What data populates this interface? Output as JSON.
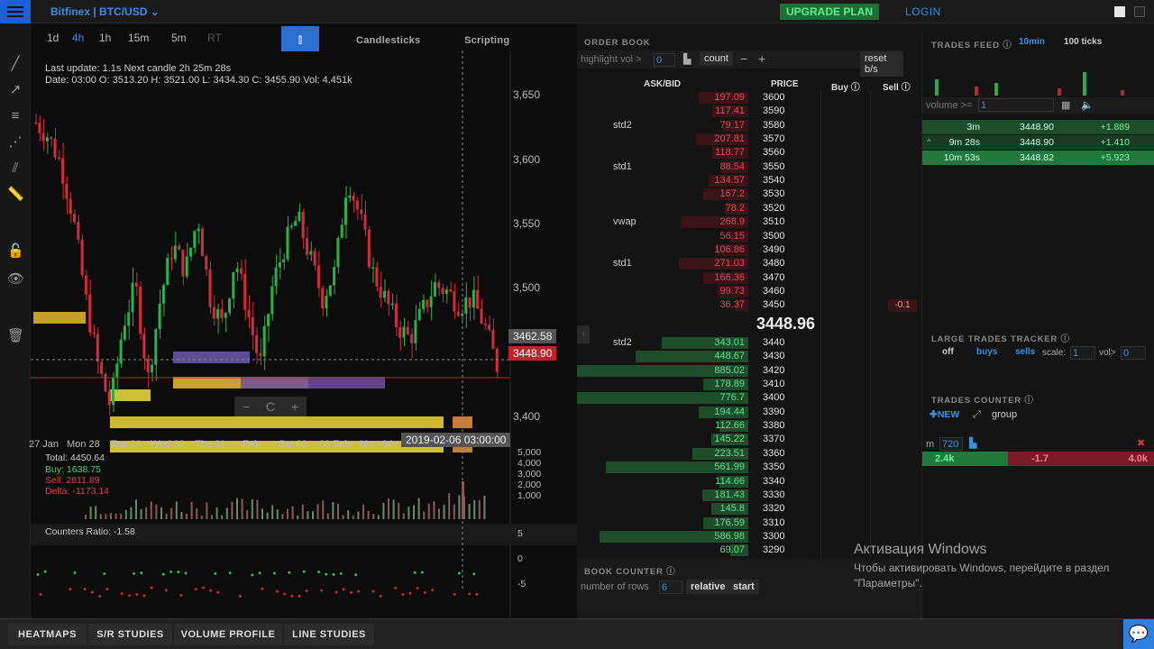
{
  "header": {
    "pair": "Bitfinex | BTC/USD",
    "upgrade": "UPGRADE PLAN",
    "login": "LOGIN"
  },
  "timeframes": [
    "1d",
    "4h",
    "1h",
    "15m",
    "5m",
    "RT"
  ],
  "tabs": {
    "candles": "Candlesticks",
    "scripting": "Scripting"
  },
  "chart": {
    "info1": "Last update: 1.1s   Next candle 2h 25m 28s",
    "info2": "Date: 03:00 O: 3513.20 H: 3521.00 L: 3434.30 C: 3455.90 Vol: 4.451k",
    "price_ticks": [
      "3,650",
      "3,600",
      "3,550",
      "3,500",
      "3,400"
    ],
    "dates": [
      "27 Jan",
      "Mon 28",
      "Tue 29",
      "Wed 30",
      "Thu 31",
      "Feb",
      "Sat 02",
      "03 Feb",
      "Mon 04"
    ],
    "crosshair_price": "3462.58",
    "last_price": "3448.90",
    "crosshair_date": "2019-02-06 03:00:00",
    "vol_ticks": [
      "5,000",
      "4,000",
      "3,000",
      "2,000",
      "1,000"
    ],
    "total": "Total: 4450.64",
    "buy": "Buy: 1638.75",
    "sell": "Sell: 2811.89",
    "delta": "Delta: -1173.14",
    "counters_ratio": "Counters Ratio: -1.58",
    "ratio_ticks": [
      "5",
      "0",
      "-5"
    ],
    "zoom_minus": "−",
    "zoom_reset": "C",
    "zoom_plus": "+"
  },
  "chart_data": {
    "type": "candlestick",
    "ylim": [
      3390,
      3670
    ],
    "title": ""
  },
  "orderbook": {
    "title": "ORDER BOOK",
    "highlight_label": "highlight vol >",
    "highlight_value": "0",
    "count": "count",
    "reset": "reset b/s",
    "col_askbid": "ASK/BID",
    "col_price": "PRICE",
    "col_buy": "Buy",
    "col_sell": "Sell",
    "asks": [
      {
        "v": "197.09",
        "p": "3600",
        "w": 55
      },
      {
        "v": "117.41",
        "p": "3590",
        "w": 40
      },
      {
        "v": "79.17",
        "p": "3580",
        "w": 28,
        "l": "std2"
      },
      {
        "v": "207.81",
        "p": "3570",
        "w": 58
      },
      {
        "v": "118.77",
        "p": "3560",
        "w": 40
      },
      {
        "v": "88.54",
        "p": "3550",
        "w": 30,
        "l": "std1"
      },
      {
        "v": "134.57",
        "p": "3540",
        "w": 44
      },
      {
        "v": "167.2",
        "p": "3530",
        "w": 50
      },
      {
        "v": "78.2",
        "p": "3520",
        "w": 26
      },
      {
        "v": "268.9",
        "p": "3510",
        "w": 75,
        "l": "vwap"
      },
      {
        "v": "56.15",
        "p": "3500",
        "w": 20
      },
      {
        "v": "106.86",
        "p": "3490",
        "w": 36
      },
      {
        "v": "271.03",
        "p": "3480",
        "w": 77,
        "l": "std1"
      },
      {
        "v": "166.36",
        "p": "3470",
        "w": 50
      },
      {
        "v": "99.73",
        "p": "3460",
        "w": 34
      },
      {
        "v": "36.37",
        "p": "3450",
        "w": 14
      }
    ],
    "mid": "3448.96",
    "sell_val": "-0.1",
    "bids": [
      {
        "v": "343.01",
        "p": "3440",
        "w": 96,
        "l": "std2"
      },
      {
        "v": "448.67",
        "p": "3430",
        "w": 125
      },
      {
        "v": "885.02",
        "p": "3420",
        "w": 190
      },
      {
        "v": "178.89",
        "p": "3410",
        "w": 50
      },
      {
        "v": "776.7",
        "p": "3400",
        "w": 190
      },
      {
        "v": "194.44",
        "p": "3390",
        "w": 55
      },
      {
        "v": "112.66",
        "p": "3380",
        "w": 32
      },
      {
        "v": "145.22",
        "p": "3370",
        "w": 41
      },
      {
        "v": "223.51",
        "p": "3360",
        "w": 62
      },
      {
        "v": "561.99",
        "p": "3350",
        "w": 158
      },
      {
        "v": "114.66",
        "p": "3340",
        "w": 32
      },
      {
        "v": "181.43",
        "p": "3330",
        "w": 51
      },
      {
        "v": "145.8",
        "p": "3320",
        "w": 41
      },
      {
        "v": "176.59",
        "p": "3310",
        "w": 50
      },
      {
        "v": "586.98",
        "p": "3300",
        "w": 165
      },
      {
        "v": "69.07",
        "p": "3290",
        "w": 20
      }
    ]
  },
  "book_counter": {
    "title": "BOOK COUNTER",
    "rows_label": "number of rows",
    "rows_value": "6",
    "relative": "relative",
    "start": "start"
  },
  "trades_feed": {
    "title": "TRADES FEED",
    "tab1": "10min",
    "tab2": "100 ticks",
    "volume_label": "volume >=",
    "volume_value": "1",
    "rows": [
      {
        "age": "3m",
        "price": "3448.90",
        "amt": "+1.889"
      },
      {
        "age": "9m 28s",
        "price": "3448.90",
        "amt": "+1.410"
      },
      {
        "age": "10m 53s",
        "price": "3448.82",
        "amt": "+5.923"
      }
    ]
  },
  "large_trades": {
    "title": "LARGE TRADES TRACKER",
    "off": "off",
    "buys": "buys",
    "sells": "sells",
    "scale_label": "scale:",
    "scale_value": "1",
    "vol_label": "vol>",
    "vol_value": "0"
  },
  "trades_counter": {
    "title": "TRADES COUNTER",
    "new": "NEW",
    "group": "group",
    "m_label": "m",
    "m_value": "720",
    "buy": "2.4k",
    "delta": "-1.7",
    "sell": "4.0k"
  },
  "watermark": {
    "line1": "Активация Windows",
    "line2": "Чтобы активировать Windows, перейдите в раздел",
    "line3": "\"Параметры\"."
  },
  "bottom_tabs": [
    "HEATMAPS",
    "S/R STUDIES",
    "VOLUME PROFILE",
    "LINE STUDIES"
  ]
}
